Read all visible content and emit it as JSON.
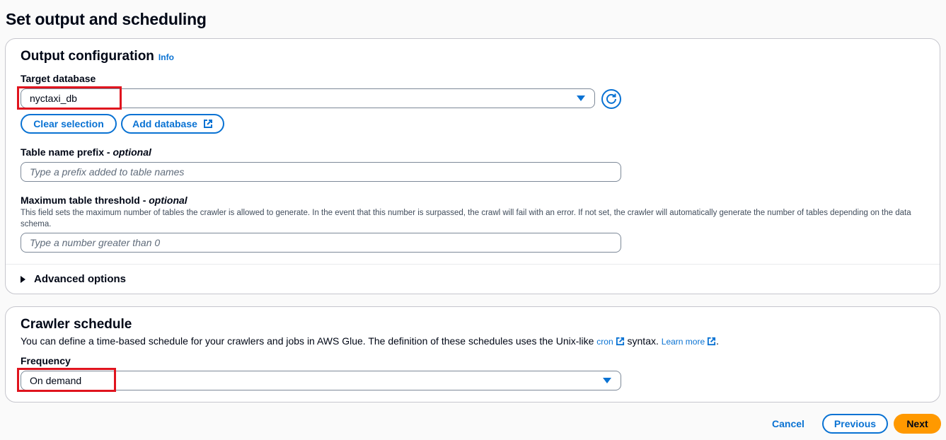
{
  "page": {
    "title": "Set output and scheduling"
  },
  "output": {
    "heading": "Output configuration",
    "info_link": "Info",
    "target_db_label": "Target database",
    "target_db_value": "nyctaxi_db",
    "clear_selection": "Clear selection",
    "add_database": "Add database",
    "prefix_label": "Table name prefix - ",
    "prefix_optional": "optional",
    "prefix_placeholder": "Type a prefix added to table names",
    "threshold_label": "Maximum table threshold - ",
    "threshold_optional": "optional",
    "threshold_desc": "This field sets the maximum number of tables the crawler is allowed to generate. In the event that this number is surpassed, the crawl will fail with an error. If not set, the crawler will automatically generate the number of tables depending on the data schema.",
    "threshold_placeholder": "Type a number greater than 0",
    "advanced_options": "Advanced options"
  },
  "schedule": {
    "heading": "Crawler schedule",
    "text_before": "You can define a time-based schedule for your crawlers and jobs in AWS Glue. The definition of these schedules uses the Unix-like ",
    "cron_link": "cron",
    "text_middle": " syntax. ",
    "learn_more": "Learn more",
    "text_end": ".",
    "frequency_label": "Frequency",
    "frequency_value": "On demand"
  },
  "footer": {
    "cancel": "Cancel",
    "previous": "Previous",
    "next": "Next"
  },
  "colors": {
    "accent": "#0972d3",
    "primary_button": "#ff9900",
    "highlight": "#e0141e"
  }
}
